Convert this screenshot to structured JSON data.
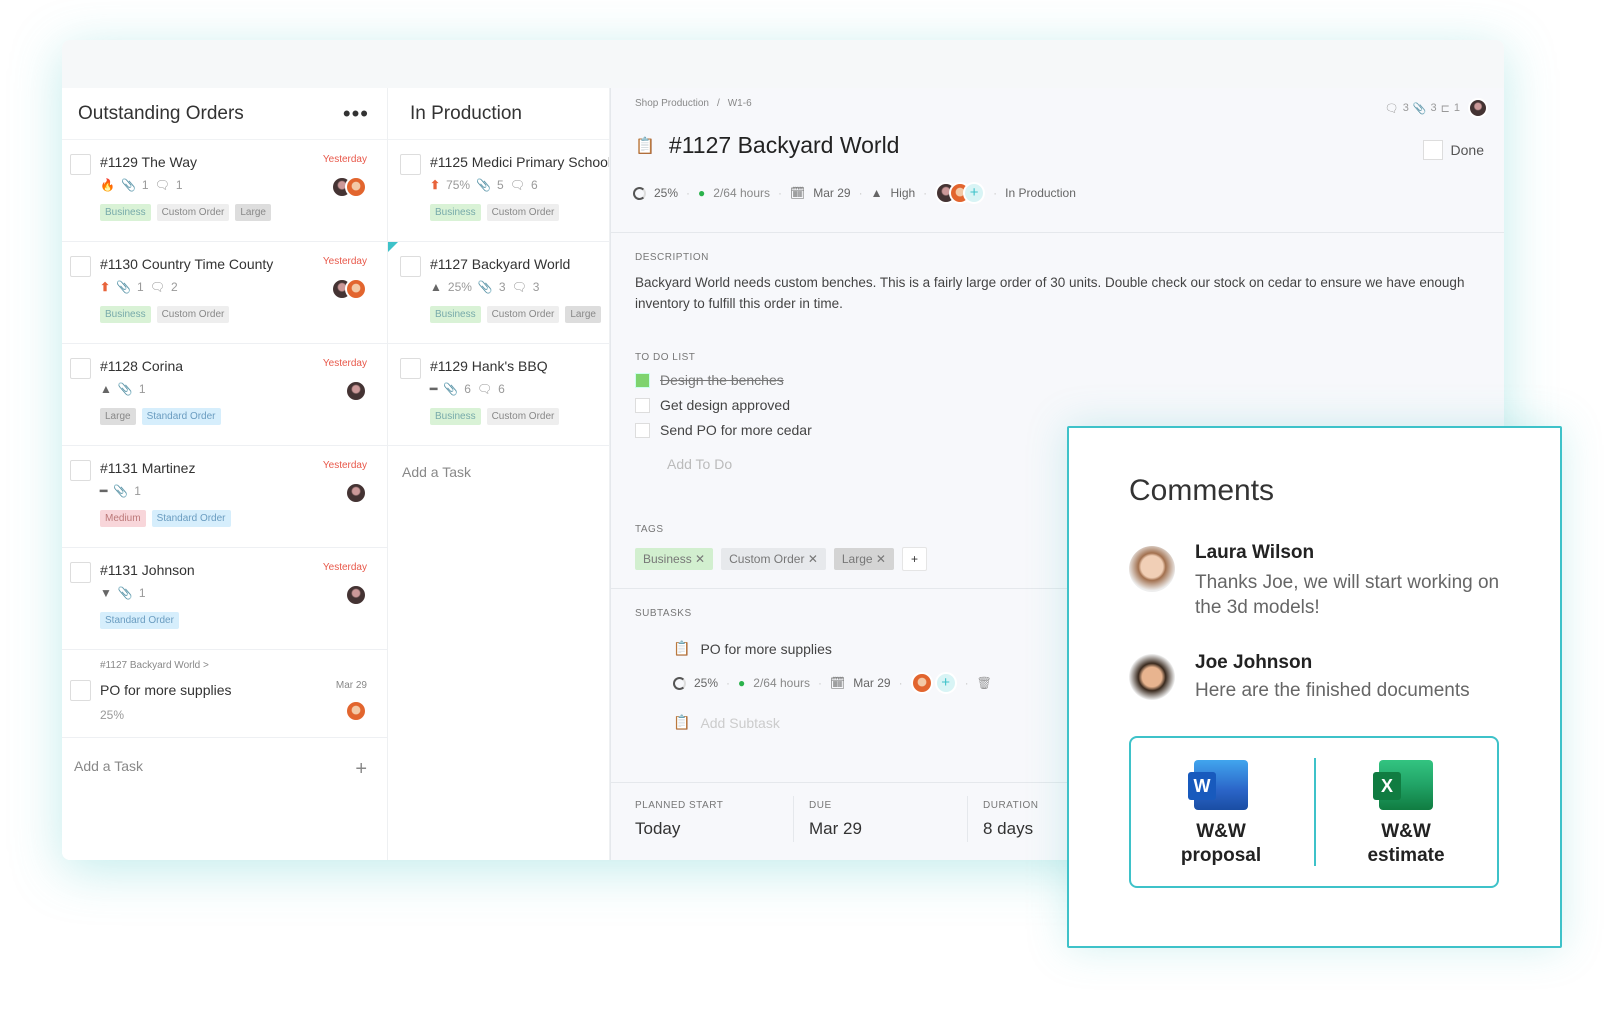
{
  "columns": [
    {
      "title": "Outstanding Orders",
      "menu_icon": "more-dots-icon",
      "cards": [
        {
          "title": "#1129 The Way",
          "date": "Yesterday",
          "priority_icon": "fire-icon",
          "attachments": "1",
          "comments": "1",
          "tags": [
            "Business",
            "Custom Order",
            "Large"
          ]
        },
        {
          "title": "#1130 Country Time County",
          "date": "Yesterday",
          "priority_icon": "arrow-up-icon",
          "attachments": "1",
          "comments": "2",
          "tags": [
            "Business",
            "Custom Order"
          ]
        },
        {
          "title": "#1128 Corina",
          "date": "Yesterday",
          "priority_icon": "triangle-up-icon",
          "attachments": "1",
          "tags": [
            "Large",
            "Standard Order"
          ]
        },
        {
          "title": "#1131 Martinez",
          "date": "Yesterday",
          "priority_icon": "dash-icon",
          "attachments": "1",
          "tags": [
            "Medium",
            "Standard Order"
          ]
        },
        {
          "title": "#1131 Johnson",
          "date": "Yesterday",
          "priority_icon": "triangle-down-icon",
          "attachments": "1",
          "tags": [
            "Standard Order"
          ]
        }
      ],
      "subtask_card": {
        "parent": "#1127 Backyard World >",
        "title": "PO for more supplies",
        "progress": "25%",
        "date": "Mar 29"
      },
      "add_task": "Add a Task"
    },
    {
      "title": "In Production",
      "cards": [
        {
          "title": "#1125 Medici Primary School",
          "progress": "75%",
          "priority_icon": "arrow-up-icon",
          "attachments": "5",
          "comments": "6",
          "tags": [
            "Business",
            "Custom Order"
          ]
        },
        {
          "title": "#1127 Backyard World",
          "progress": "25%",
          "priority_icon": "triangle-up-icon",
          "attachments": "3",
          "comments": "3",
          "tags": [
            "Business",
            "Custom Order",
            "Large"
          ]
        },
        {
          "title": "#1129 Hank's BBQ",
          "priority_icon": "dash-icon",
          "attachments": "6",
          "comments": "6",
          "tags": [
            "Business",
            "Custom Order"
          ]
        }
      ],
      "add_task": "Add a Task"
    }
  ],
  "detail": {
    "breadcrumb": [
      "Shop Production",
      "/",
      "W1-6"
    ],
    "counts": {
      "comments": "3",
      "attachments": "3",
      "subtasks": "1"
    },
    "title": "#1127 Backyard World",
    "done_label": "Done",
    "progress": "25%",
    "hours": "2/64 hours",
    "due": "Mar 29",
    "priority": "High",
    "status": "In Production",
    "description_label": "DESCRIPTION",
    "description": "Backyard World needs custom benches. This is a fairly large order of 30 units. Double check our stock on cedar to ensure we have enough inventory to fulfill this order in time.",
    "todo_label": "TO DO LIST",
    "todos": [
      {
        "text": "Design the benches",
        "done": true
      },
      {
        "text": "Get design approved",
        "done": false
      },
      {
        "text": "Send PO for more cedar",
        "done": false
      }
    ],
    "add_todo": "Add To Do",
    "tags_label": "TAGS",
    "tags": [
      "Business",
      "Custom Order",
      "Large"
    ],
    "add_tag": "+",
    "subtasks_label": "SUBTASKS",
    "subtask": {
      "title": "PO for more supplies",
      "progress": "25%",
      "hours": "2/64 hours",
      "due": "Mar 29"
    },
    "add_subtask": "Add Subtask",
    "footer": [
      {
        "label": "PLANNED START",
        "value": "Today"
      },
      {
        "label": "DUE",
        "value": "Mar 29"
      },
      {
        "label": "DURATION",
        "value": "8 days"
      }
    ]
  },
  "comments": {
    "title": "Comments",
    "items": [
      {
        "name": "Laura Wilson",
        "text": "Thanks Joe, we will start working on the 3d models!"
      },
      {
        "name": "Joe Johnson",
        "text": "Here are the finished documents"
      }
    ],
    "files": [
      {
        "name": "W&W proposal",
        "icon": "word-icon",
        "letter": "W"
      },
      {
        "name": "W&W estimate",
        "icon": "excel-icon",
        "letter": "X"
      }
    ]
  },
  "colors": {
    "accent": "#3ec2c9",
    "danger": "#e8584a",
    "word": "#2b65c8",
    "excel": "#1e8a4c"
  }
}
